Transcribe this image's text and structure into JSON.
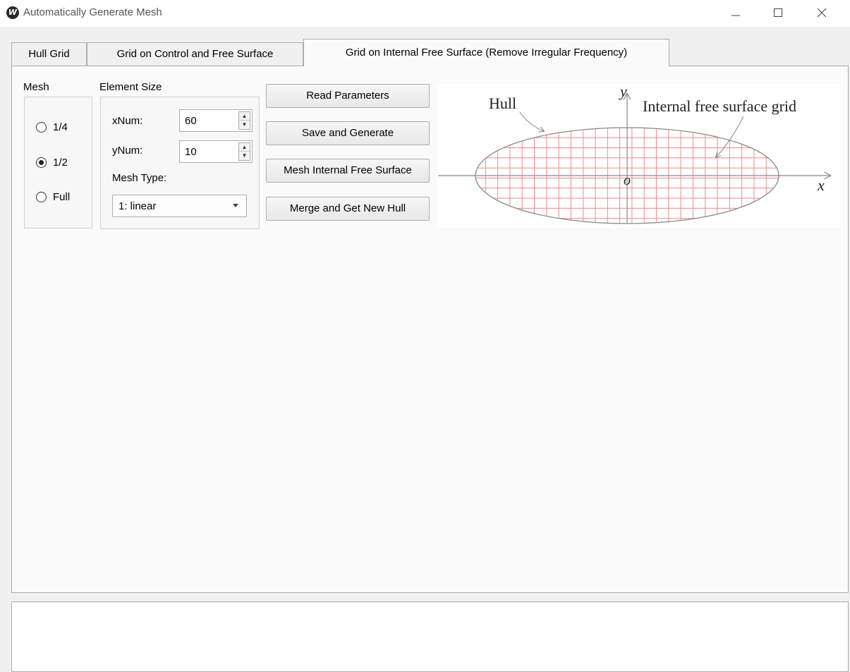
{
  "window": {
    "title": "Automatically Generate Mesh",
    "app_icon_glyph": "W",
    "controls": [
      "minimize-icon",
      "maximize-icon",
      "close-icon"
    ]
  },
  "tabs": [
    {
      "label": "Hull Grid",
      "active": false
    },
    {
      "label": "Grid on Control and Free Surface",
      "active": false
    },
    {
      "label": "Grid on Internal Free Surface (Remove Irregular Frequency)",
      "active": true
    }
  ],
  "mesh_group": {
    "label": "Mesh",
    "options": [
      {
        "label": "1/4",
        "checked": false
      },
      {
        "label": "1/2",
        "checked": true
      },
      {
        "label": "Full",
        "checked": false
      }
    ]
  },
  "element_size": {
    "label": "Element Size",
    "xnum_label": "xNum:",
    "xnum_value": "60",
    "ynum_label": "yNum:",
    "ynum_value": "10",
    "mesh_type_label": "Mesh Type:",
    "mesh_type_value": "1: linear"
  },
  "buttons": {
    "read": "Read Parameters",
    "save": "Save and Generate",
    "mesh_internal": "Mesh Internal Free Surface",
    "merge": "Merge and Get New Hull"
  },
  "diagram": {
    "hull_label": "Hull",
    "grid_label": "Internal free surface grid",
    "x_axis": "x",
    "y_axis": "y",
    "origin": "o",
    "colors": {
      "grid": "#f08a8a",
      "outline": "#888888",
      "axis": "#888888"
    }
  },
  "log": {
    "text": ""
  }
}
